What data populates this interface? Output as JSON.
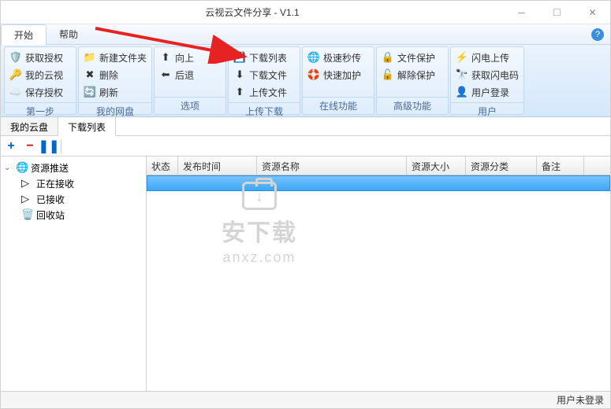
{
  "window": {
    "title": "云视云文件分享 - V1.1"
  },
  "menu": {
    "tabs": [
      "开始",
      "帮助"
    ]
  },
  "ribbon": {
    "groups": [
      {
        "label": "第一步",
        "items": [
          {
            "icon": "🛡️",
            "text": "获取授权"
          },
          {
            "icon": "🔑",
            "text": "我的云视"
          },
          {
            "icon": "☁️",
            "text": "保存授权"
          }
        ]
      },
      {
        "label": "我的网盘",
        "items": [
          {
            "icon": "📁",
            "text": "新建文件夹"
          },
          {
            "icon": "✖",
            "text": "删除"
          },
          {
            "icon": "🔄",
            "text": "刷新"
          }
        ]
      },
      {
        "label": "选项",
        "items": [
          {
            "icon": "⬆",
            "text": "向上"
          },
          {
            "icon": "⬅",
            "text": "后退"
          }
        ]
      },
      {
        "label": "上传下载",
        "items": [
          {
            "icon": "💾",
            "text": "下载列表"
          },
          {
            "icon": "⬇",
            "text": "下载文件"
          },
          {
            "icon": "⬆",
            "text": "上传文件"
          }
        ]
      },
      {
        "label": "在线功能",
        "items": [
          {
            "icon": "🌐",
            "text": "极速秒传"
          },
          {
            "icon": "🛟",
            "text": "快速加护"
          }
        ]
      },
      {
        "label": "高级功能",
        "items": [
          {
            "icon": "🔒",
            "text": "文件保护"
          },
          {
            "icon": "🔓",
            "text": "解除保护"
          }
        ]
      },
      {
        "label": "用户",
        "items": [
          {
            "icon": "⚡",
            "text": "闪电上传"
          },
          {
            "icon": "🔭",
            "text": "获取闪电码"
          },
          {
            "icon": "👤",
            "text": "用户登录"
          }
        ]
      }
    ]
  },
  "content_tabs": [
    "我的云盘",
    "下载列表"
  ],
  "tree": {
    "root": "资源推送",
    "children": [
      "正在接收",
      "已接收",
      "回收站"
    ]
  },
  "grid": {
    "columns": [
      {
        "label": "状态",
        "width": 40
      },
      {
        "label": "发布时间",
        "width": 100
      },
      {
        "label": "资源名称",
        "width": 190
      },
      {
        "label": "资源大小",
        "width": 75
      },
      {
        "label": "资源分类",
        "width": 90
      },
      {
        "label": "备注",
        "width": 60
      }
    ]
  },
  "status": {
    "text": "用户未登录"
  },
  "watermark": {
    "text": "安下载",
    "url": "anxz.com"
  }
}
